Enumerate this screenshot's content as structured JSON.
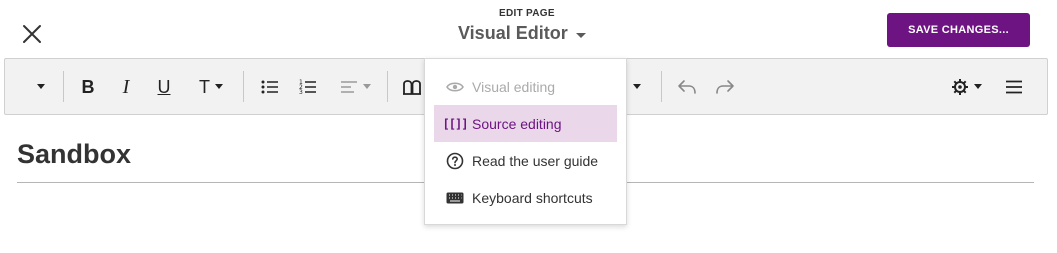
{
  "header": {
    "edit_label": "EDIT PAGE",
    "mode_title": "Visual Editor",
    "save_label": "SAVE CHANGES..."
  },
  "toolbar": {
    "items": [
      {
        "name": "heading-format",
        "icon": "chevron-down-icon"
      },
      {
        "name": "bold",
        "icon": "bold-icon",
        "glyph": "B"
      },
      {
        "name": "italic",
        "icon": "italic-icon",
        "glyph": "I"
      },
      {
        "name": "underline",
        "icon": "underline-icon",
        "glyph": "U"
      },
      {
        "name": "text-style",
        "icon": "text-style-icon",
        "glyph": "T"
      },
      {
        "name": "bullet-list",
        "icon": "bullet-list-icon"
      },
      {
        "name": "numbered-list",
        "icon": "numbered-list-icon"
      },
      {
        "name": "align",
        "icon": "align-icon"
      },
      {
        "name": "cite",
        "icon": "book-icon"
      },
      {
        "name": "insert",
        "icon": "chevron-down-icon"
      },
      {
        "name": "undo",
        "icon": "undo-icon"
      },
      {
        "name": "redo",
        "icon": "redo-icon"
      },
      {
        "name": "page-options",
        "icon": "gear-icon"
      },
      {
        "name": "menu",
        "icon": "hamburger-icon"
      }
    ]
  },
  "menu": {
    "items": [
      {
        "label": "Visual editing",
        "icon": "eye-icon",
        "state": "disabled"
      },
      {
        "label": "Source editing",
        "icon": "source-bracket-icon",
        "state": "selected",
        "icon_glyph": "[[]]"
      },
      {
        "label": "Read the user guide",
        "icon": "help-circle-icon",
        "state": "normal"
      },
      {
        "label": "Keyboard shortcuts",
        "icon": "keyboard-icon",
        "state": "normal"
      }
    ]
  },
  "page": {
    "title": "Sandbox"
  },
  "colors": {
    "accent": "#6d1482",
    "selected_bg": "#ead8ea",
    "toolbar_bg": "#f2f2f2"
  }
}
